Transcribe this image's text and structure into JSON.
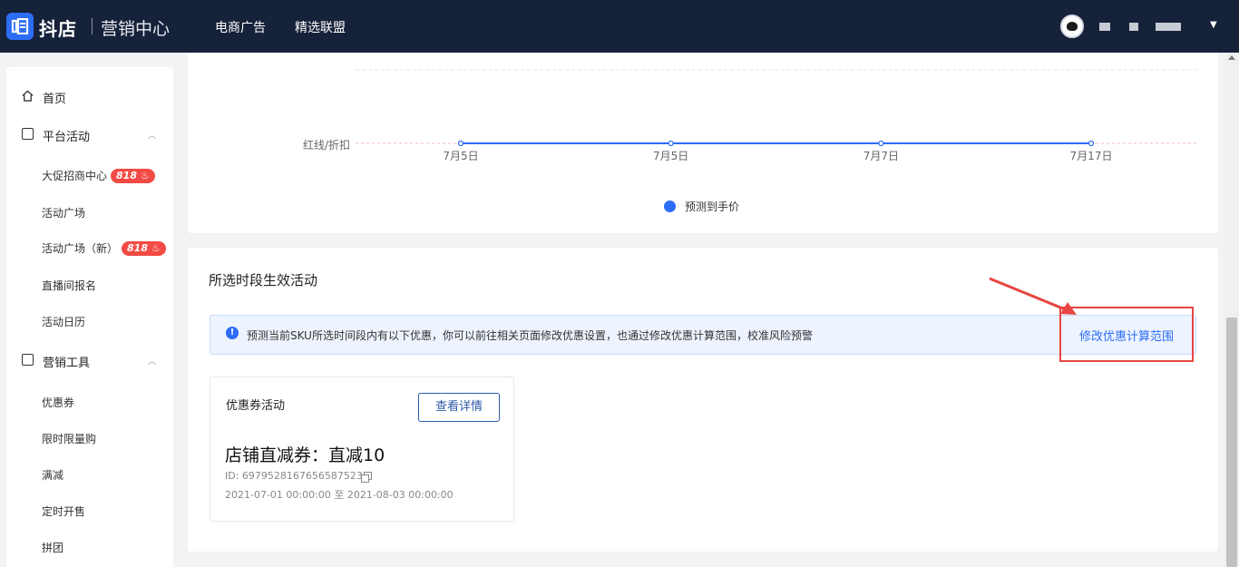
{
  "header": {
    "brand": "抖店",
    "subtitle": "营销中心",
    "nav": [
      "电商广告",
      "精选联盟"
    ]
  },
  "sidebar": {
    "home": "首页",
    "groups": [
      {
        "label": "平台活动",
        "items": [
          {
            "label": "大促招商中心",
            "badge": "818"
          },
          {
            "label": "活动广场",
            "badge": ""
          },
          {
            "label": "活动广场（新）",
            "badge": "818"
          },
          {
            "label": "直播间报名",
            "badge": ""
          },
          {
            "label": "活动日历",
            "badge": ""
          }
        ]
      },
      {
        "label": "营销工具",
        "items": [
          {
            "label": "优惠券"
          },
          {
            "label": "限时限量购"
          },
          {
            "label": "满减"
          },
          {
            "label": "定时开售"
          },
          {
            "label": "拼团"
          }
        ]
      }
    ]
  },
  "chart_data": {
    "type": "line",
    "categories": [
      "7月5日",
      "7月5日",
      "7月7日",
      "7月17日"
    ],
    "series": [
      {
        "name": "预测到手价",
        "values": [
          0,
          0,
          0,
          0
        ]
      }
    ],
    "reference_line": "红线/折扣",
    "legend_position": "bottom",
    "color": "#2c6cf6"
  },
  "activities": {
    "title": "所选时段生效活动",
    "notice": "预测当前SKU所选时间段内有以下优惠，你可以前往相关页面修改优惠设置，也通过修改优惠计算范围，校准风险预警",
    "notice_link": "修改优惠计算范围",
    "coupon": {
      "type": "优惠券活动",
      "button": "查看详情",
      "name": "店铺直减券：直减10",
      "id": "ID: 6979528167656587523",
      "period": "2021-07-01 00:00:00 至 2021-08-03 00:00:00"
    }
  }
}
